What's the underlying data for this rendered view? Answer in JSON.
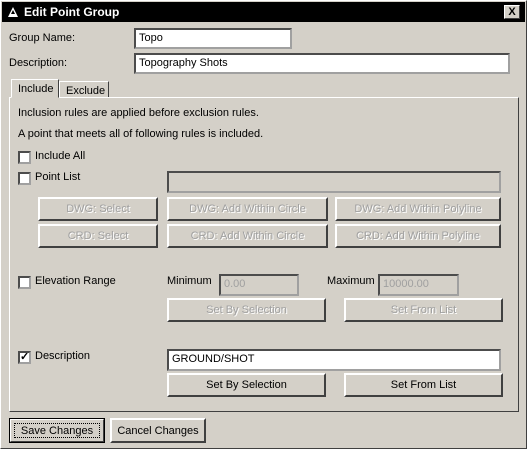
{
  "window": {
    "title": "Edit Point Group",
    "close_label": "X"
  },
  "group_name": {
    "label": "Group Name:",
    "value": "Topo"
  },
  "description_field": {
    "label": "Description:",
    "value": "Topography Shots"
  },
  "tabs": [
    {
      "label": "Include",
      "active": true
    },
    {
      "label": "Exclude",
      "active": false
    }
  ],
  "include": {
    "info_line_1": "Inclusion rules are applied before exclusion rules.",
    "info_line_2": "A point that meets all of following rules is included.",
    "include_all": {
      "label": "Include All",
      "checked": false
    },
    "point_list": {
      "label": "Point List",
      "checked": false,
      "value": "",
      "buttons": {
        "dwg_select": "DWG: Select",
        "dwg_circle": "DWG: Add Within Circle",
        "dwg_polyline": "DWG: Add Within Polyline",
        "crd_select": "CRD: Select",
        "crd_circle": "CRD: Add Within Circle",
        "crd_polyline": "CRD: Add Within Polyline"
      }
    },
    "elevation_range": {
      "label": "Elevation Range",
      "checked": false,
      "minimum_label": "Minimum",
      "minimum_value": "0.00",
      "maximum_label": "Maximum",
      "maximum_value": "10000.00",
      "set_by_selection": "Set By Selection",
      "set_from_list": "Set From List"
    },
    "description_rule": {
      "label": "Description",
      "checked": true,
      "check_mark": "✓",
      "value": "GROUND/SHOT",
      "set_by_selection": "Set By Selection",
      "set_from_list": "Set From List"
    }
  },
  "footer": {
    "save_label": "Save Changes",
    "cancel_label": "Cancel Changes"
  },
  "colors": {
    "face": "#d4d0c8",
    "titlebar": "#000000",
    "disabled_text": "#a0a0a0"
  }
}
